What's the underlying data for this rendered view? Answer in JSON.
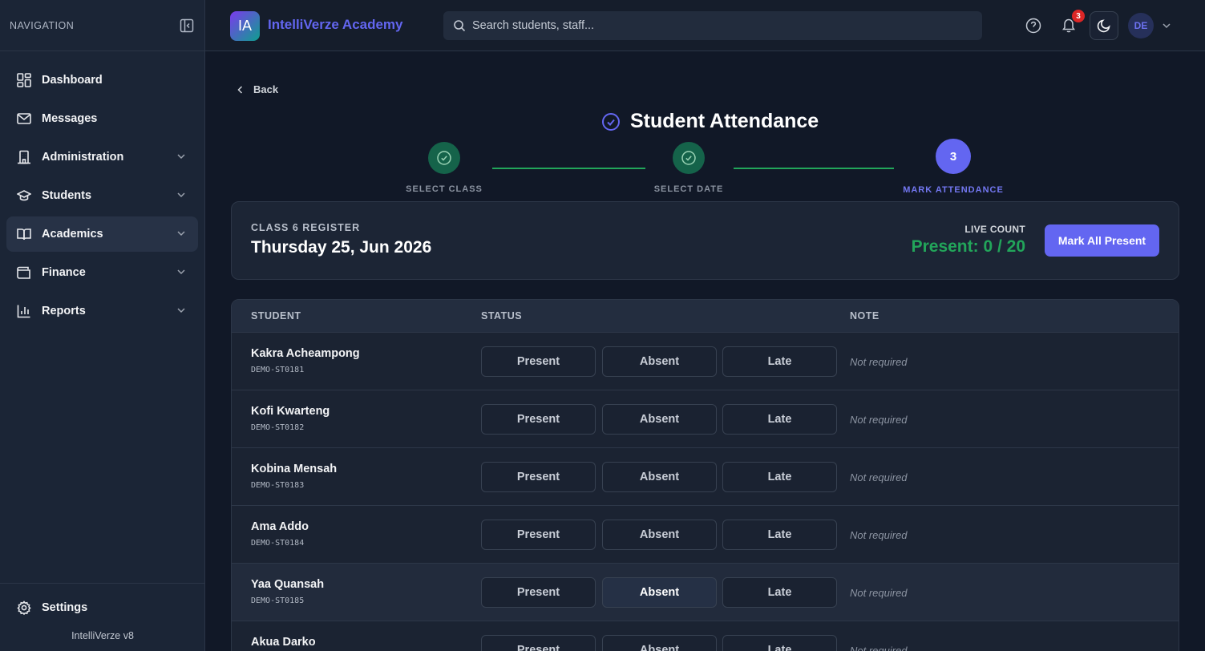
{
  "sidebar": {
    "header": "NAVIGATION",
    "items": [
      {
        "label": "Dashboard",
        "icon": "dashboard-icon",
        "active": false,
        "expandable": false
      },
      {
        "label": "Messages",
        "icon": "mail-icon",
        "active": false,
        "expandable": false
      },
      {
        "label": "Administration",
        "icon": "building-icon",
        "active": false,
        "expandable": true
      },
      {
        "label": "Students",
        "icon": "graduation-cap-icon",
        "active": false,
        "expandable": true
      },
      {
        "label": "Academics",
        "icon": "book-open-icon",
        "active": true,
        "expandable": true
      },
      {
        "label": "Finance",
        "icon": "wallet-icon",
        "active": false,
        "expandable": true
      },
      {
        "label": "Reports",
        "icon": "bar-chart-icon",
        "active": false,
        "expandable": true
      }
    ],
    "settings_label": "Settings",
    "version": "IntelliVerze v8"
  },
  "topbar": {
    "logo_text": "IA",
    "brand": "IntelliVerze Academy",
    "search_placeholder": "Search students, staff...",
    "notification_count": "3",
    "avatar_initials": "DE"
  },
  "page": {
    "back_label": "Back",
    "title": "Student Attendance",
    "steps": [
      {
        "label": "SELECT CLASS",
        "state": "done"
      },
      {
        "label": "SELECT DATE",
        "state": "done"
      },
      {
        "label": "MARK ATTENDANCE",
        "state": "current",
        "number": "3"
      }
    ]
  },
  "register": {
    "class_label": "CLASS 6 REGISTER",
    "date": "Thursday 25, Jun 2026",
    "live_count_label": "LIVE COUNT",
    "live_count_value": "Present: 0 / 20",
    "mark_all_label": "Mark All Present"
  },
  "table": {
    "headers": {
      "student": "STUDENT",
      "status": "STATUS",
      "note": "NOTE"
    },
    "status_options": [
      "Present",
      "Absent",
      "Late"
    ],
    "rows": [
      {
        "name": "Kakra Acheampong",
        "id": "DEMO-ST0181",
        "note": "Not required"
      },
      {
        "name": "Kofi Kwarteng",
        "id": "DEMO-ST0182",
        "note": "Not required"
      },
      {
        "name": "Kobina Mensah",
        "id": "DEMO-ST0183",
        "note": "Not required"
      },
      {
        "name": "Ama Addo",
        "id": "DEMO-ST0184",
        "note": "Not required"
      },
      {
        "name": "Yaa Quansah",
        "id": "DEMO-ST0185",
        "note": "Not required"
      },
      {
        "name": "Akua Darko",
        "id": "",
        "note": "Not required"
      }
    ]
  },
  "colors": {
    "accent": "#6366f1",
    "success": "#22a55a",
    "background": "#111827",
    "sidebar": "#1b2536"
  }
}
